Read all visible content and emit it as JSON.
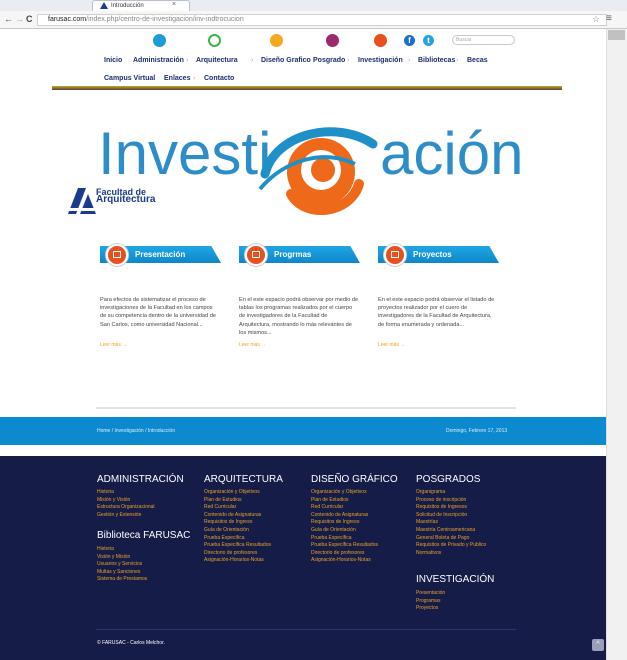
{
  "browser": {
    "tab_title": "Introducción",
    "tab_close": "×",
    "url_host": "farusac.com",
    "url_path": "/index.php/centro-de-investigacion/inv-indtrocucion",
    "back": "←",
    "forward": "→",
    "reload": "C",
    "star": "☆",
    "menu": "≡"
  },
  "header": {
    "search_placeholder": "Buscar",
    "social": [
      "f",
      "t"
    ],
    "nav_row1": [
      "Inicio",
      "Administración",
      "Arquitectura",
      "Diseño Grafico",
      "Posgrado",
      "Investigación",
      "Bibliotecas",
      "Becas"
    ],
    "nav_row2": [
      "Campus Virtual",
      "Enlaces",
      "Contacto"
    ]
  },
  "hero": {
    "title_pre": "Investi",
    "title_post": "ación",
    "logo_line1": "Facultad de",
    "logo_line2": "Arquitectura"
  },
  "cards": [
    {
      "title": "Presentación",
      "text": "Para efectos de sistematizar el proceso de investigaciones de la Facultad en los campos de su competencia dentro de la universidad de San Carlos, como universidad Nacional...",
      "more": "Leer más →"
    },
    {
      "title": "Progrmas",
      "text": "En el este espacio podrá observar por medio de tablas los programas realizados por el cuerpo de investigadores de la Facultad de Arquitectura, mostrando lo más relevantes de los mismos...",
      "more": "Leer más →"
    },
    {
      "title": "Proyectos",
      "text": "En el este espacio podrá observar el listado de proyectos realizador por el cuero de investigadores de la Facultad de Arquitectura, de forma enumerada y ordenada...",
      "more": "Leer más →"
    }
  ],
  "bar": {
    "breadcrumb": "Home / Investigación / Introducción",
    "date": "Domingo, Febrero 17, 2013"
  },
  "footer": {
    "col1_heading": "ADMINISTRACIÓN",
    "col1_links": [
      "Historia",
      "Misión y Visión",
      "Estructura Organizacional",
      "Gestión y Extensión"
    ],
    "col1b_heading": "Biblioteca FARUSAC",
    "col1b_links": [
      "Historia",
      "Visión y Misión",
      "Usuarios y Servicios",
      "Multas y Sanciones",
      "Sistema de Prestamos"
    ],
    "col2_heading": "ARQUITECTURA",
    "col2_links": [
      "Organización y Objetivos",
      "Plan de Estudios",
      "Red Curricular",
      "Contenido de Asignaturas",
      "Requisitos de Ingreso",
      "Guía de Orientación",
      "Prueba Específica",
      "Prueba Específica Resultados",
      "Directorio de profesores",
      "Asignación-Horarios-Notas"
    ],
    "col3_heading": "DISEÑO GRÁFICO",
    "col3_links": [
      "Organización y Objetivos",
      "Plan de Estudios",
      "Red Curricular",
      "Contenido de Asignaturas",
      "Requisitos de Ingreso",
      "Guía de Orientación",
      "Prueba Específica",
      "Prueba Específica Resultados",
      "Directorio de profesores",
      "Asignación-Horarios-Notas"
    ],
    "col4_heading": "POSGRADOS",
    "col4_links": [
      "Organigrama",
      "Proceso de inscripción",
      "Requisitos de Ingresos",
      "Solicitud de Inscripción",
      "Maestrías",
      "Maestría Centroamericana",
      "General Boleta de Pago",
      "Requisitos de Privado y Publico",
      "Normativos"
    ],
    "col4b_heading": "INVESTIGACIÓN",
    "col4b_links": [
      "Presentación",
      "Programas",
      "Proyectos"
    ],
    "copyright": "© FARUSAC - Carlos Melchor.",
    "totop": "^"
  }
}
